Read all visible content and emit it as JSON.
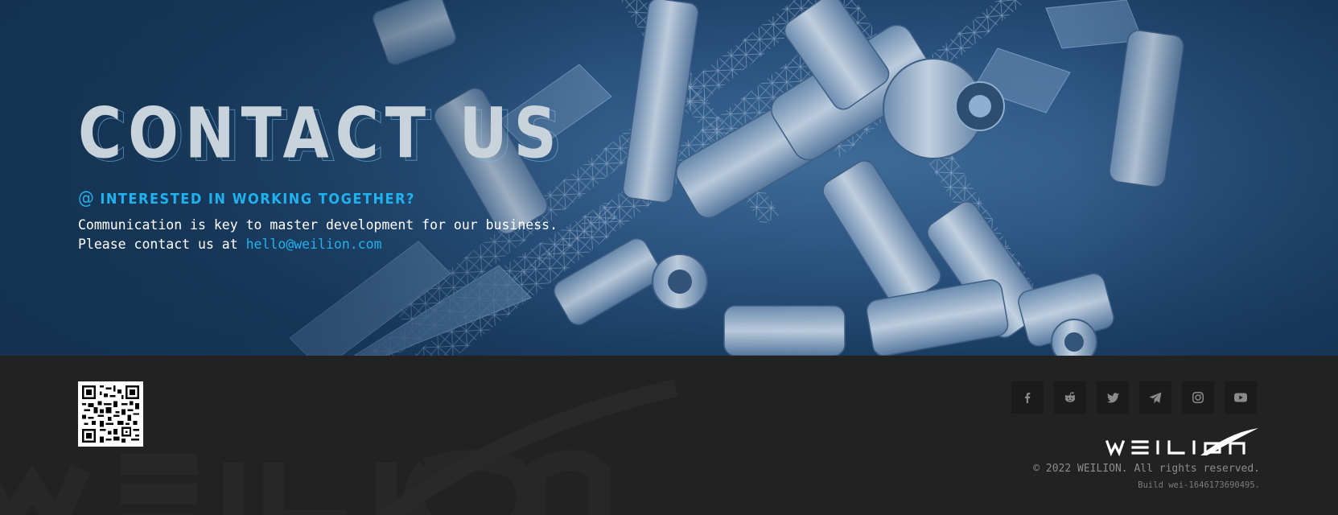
{
  "hero": {
    "title": "CONTACT US",
    "subtitle_icon": "at-icon",
    "subtitle_at": "@",
    "subtitle": "INTERESTED IN WORKING TOGETHER?",
    "line1": "Communication is key to master development for our business.",
    "line2_prefix": "Please contact us at ",
    "email": "hello@weilion.com",
    "accent_color": "#1fb2ee",
    "background": "space-station-image"
  },
  "footer": {
    "qr_code": "qr-code-image",
    "social": [
      {
        "name": "facebook-icon"
      },
      {
        "name": "reddit-icon"
      },
      {
        "name": "twitter-icon"
      },
      {
        "name": "telegram-icon"
      },
      {
        "name": "instagram-icon"
      },
      {
        "name": "youtube-icon"
      }
    ],
    "brand_logo": "WEILION",
    "copyright": "© 2022 WEILION. All rights reserved.",
    "build": "Build wei-1646173690495."
  }
}
